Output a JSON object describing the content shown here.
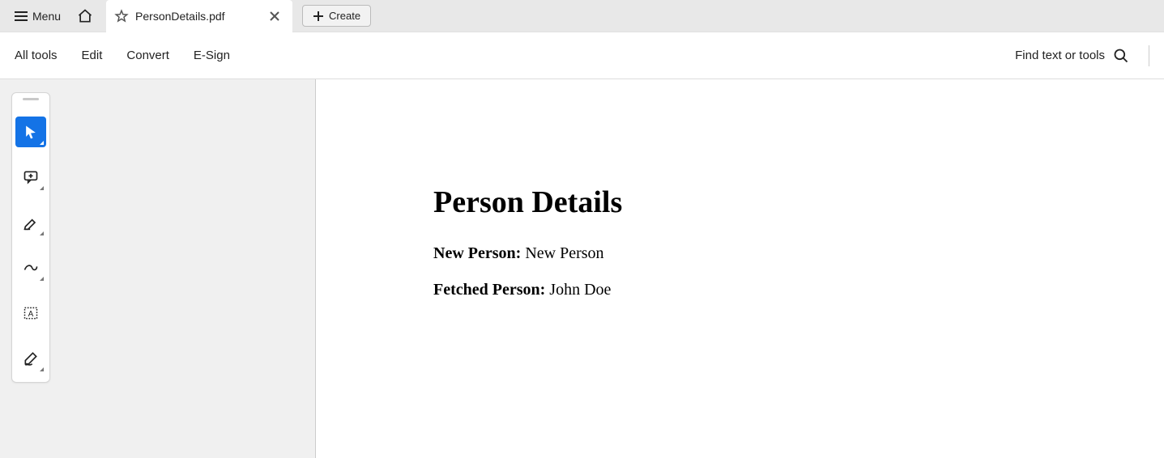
{
  "titlebar": {
    "menu_label": "Menu",
    "doc_title": "PersonDetails.pdf",
    "create_label": "Create"
  },
  "menubar": {
    "items": [
      "All tools",
      "Edit",
      "Convert",
      "E-Sign"
    ],
    "find_label": "Find text or tools"
  },
  "document": {
    "heading": "Person Details",
    "rows": [
      {
        "label": "New Person:",
        "value": "New Person"
      },
      {
        "label": "Fetched Person:",
        "value": "John Doe"
      }
    ]
  }
}
